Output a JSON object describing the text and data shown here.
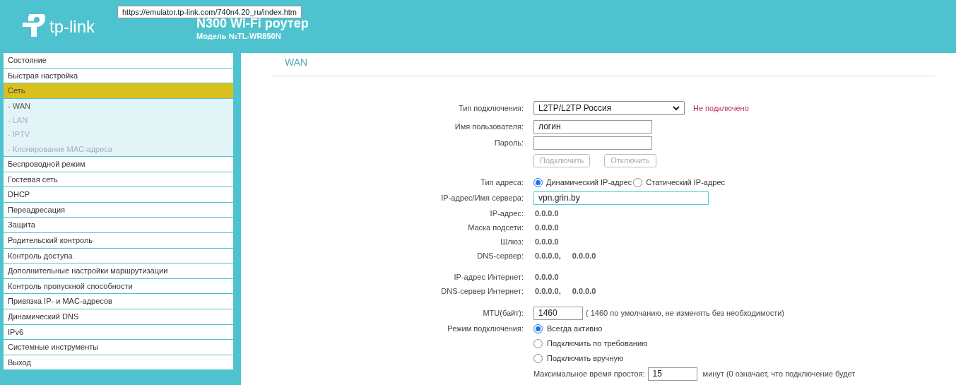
{
  "tooltip": "https://emulator.tp-link.com/740n4.20_ru/index.htm",
  "header": {
    "logo_text": "tp-link",
    "title": "N300 Wi-Fi роутер",
    "model": "Модель №TL-WR850N"
  },
  "sidebar": {
    "items": [
      {
        "label": "Состояние",
        "selected": false
      },
      {
        "label": "Быстрая настройка",
        "selected": false
      },
      {
        "label": "Сеть",
        "selected": true,
        "children": [
          {
            "label": "- WAN",
            "selected": true
          },
          {
            "label": "- LAN",
            "selected": false
          },
          {
            "label": "- IPTV",
            "selected": false
          },
          {
            "label": "- Клонирование MAC-адреса",
            "selected": false
          }
        ]
      },
      {
        "label": "Беспроводной режим",
        "selected": false
      },
      {
        "label": "Гостевая сеть",
        "selected": false
      },
      {
        "label": "DHCP",
        "selected": false
      },
      {
        "label": "Переадресация",
        "selected": false
      },
      {
        "label": "Защита",
        "selected": false
      },
      {
        "label": "Родительский контроль",
        "selected": false
      },
      {
        "label": "Контроль доступа",
        "selected": false
      },
      {
        "label": "Дополнительные настройки маршрутизации",
        "selected": false
      },
      {
        "label": "Контроль пропускной способности",
        "selected": false
      },
      {
        "label": "Привязка IP- и MAC-адресов",
        "selected": false
      },
      {
        "label": "Динамический DNS",
        "selected": false
      },
      {
        "label": "IPv6",
        "selected": false
      },
      {
        "label": "Системные инструменты",
        "selected": false
      },
      {
        "label": "Выход",
        "selected": false
      }
    ]
  },
  "page_title": "WAN",
  "form": [
    {
      "kind": "select",
      "label": "Тип подключения:",
      "value": "L2TP/L2TP Россия",
      "status": "Не подключено"
    },
    {
      "kind": "input",
      "label": "Имя пользователя:",
      "value": "логин"
    },
    {
      "kind": "input",
      "label": "Пароль:"
    },
    {
      "kind": "buttons",
      "buttons": [
        {
          "label": "Подключить",
          "disabled": true
        },
        {
          "label": "Отключить",
          "disabled": true
        }
      ]
    },
    {
      "kind": "radio",
      "label": "Тип адреса:",
      "options": [
        {
          "label": "Динамический IP-адрес",
          "selected": true
        },
        {
          "label": "Статический IP-адрес",
          "selected": false
        }
      ]
    },
    {
      "kind": "wide_input",
      "label": "IP-адрес/Имя сервера:",
      "value": "vpn.grin.by",
      "focused": true
    },
    {
      "kind": "values",
      "label": "IP-адрес:",
      "values": [
        "0.0.0.0"
      ]
    },
    {
      "kind": "values",
      "label": "Маска подсети:",
      "values": [
        "0.0.0.0"
      ]
    },
    {
      "kind": "values",
      "label": "Шлюз:",
      "values": [
        "0.0.0.0"
      ]
    },
    {
      "kind": "values",
      "label": "DNS-сервер:",
      "values": [
        "0.0.0.0,",
        "0.0.0.0"
      ]
    },
    {
      "kind": "spacer"
    },
    {
      "kind": "values",
      "label": "IP-адрес Интернет:",
      "values": [
        "0.0.0.0"
      ]
    },
    {
      "kind": "values",
      "label": "DNS-сервер Интернет:",
      "values": [
        "0.0.0.0,",
        "0.0.0.0"
      ]
    },
    {
      "kind": "spacer"
    },
    {
      "kind": "short_input",
      "label": "MTU(байт):",
      "value": "1460",
      "hint": "( 1460 по умолчанию, не изменять без необходимости)"
    },
    {
      "kind": "radiolist",
      "label": "Режим подключения:",
      "options": [
        {
          "label": "Всегда активно",
          "selected": true
        },
        {
          "label": "Подключить по требованию",
          "selected": false
        },
        {
          "label": "Подключить вручную",
          "selected": false
        }
      ]
    },
    {
      "kind": "idle",
      "label": "Максимальное время простоя:",
      "value": "15",
      "hint": "минут (0 означает, что подключение будет"
    }
  ]
}
